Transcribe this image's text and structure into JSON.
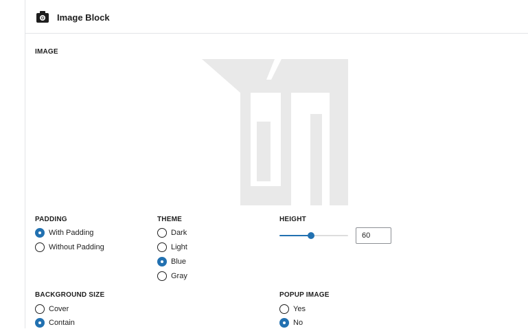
{
  "block": {
    "title": "Image Block",
    "icon": "camera-icon"
  },
  "image": {
    "label": "IMAGE",
    "placeholder_icon": "wordpress-placeholder-icon"
  },
  "padding": {
    "label": "PADDING",
    "options": [
      "With Padding",
      "Without Padding"
    ],
    "selected": "With Padding"
  },
  "theme": {
    "label": "THEME",
    "options": [
      "Dark",
      "Light",
      "Blue",
      "Gray"
    ],
    "selected": "Blue"
  },
  "height": {
    "label": "HEIGHT",
    "value": "60",
    "slider_fraction": 0.46
  },
  "background_size": {
    "label": "BACKGROUND SIZE",
    "options": [
      "Cover",
      "Contain"
    ],
    "selected": "Contain"
  },
  "popup_image": {
    "label": "POPUP IMAGE",
    "options": [
      "Yes",
      "No"
    ],
    "selected": "No"
  },
  "colors": {
    "accent": "#2271b1",
    "border": "#e2e4e7",
    "placeholder": "#e9e9e9"
  }
}
